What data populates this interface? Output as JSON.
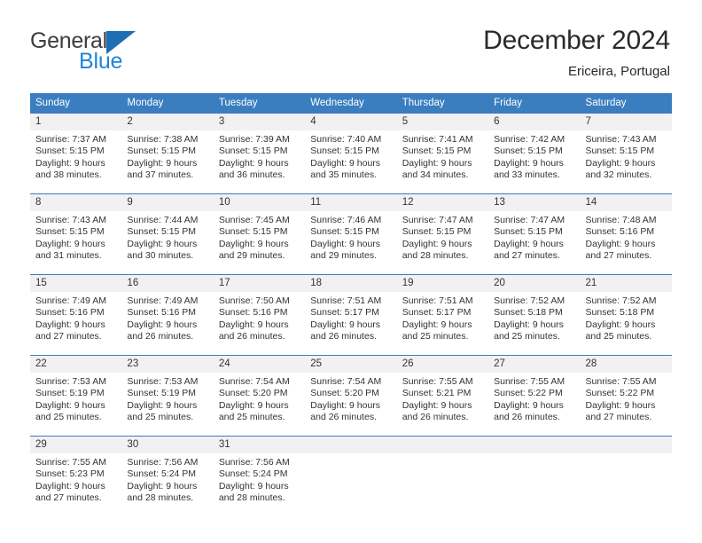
{
  "brand": {
    "name_top": "General",
    "name_bottom": "Blue",
    "triangle_color": "#1c6fb5",
    "blue_text_color": "#1f84d6"
  },
  "header": {
    "title": "December 2024",
    "subtitle": "Ericeira, Portugal"
  },
  "theme": {
    "header_blue": "#3a7ebf",
    "daynum_background": "#f1f1f1",
    "text_color": "#333333"
  },
  "weekdays": [
    "Sunday",
    "Monday",
    "Tuesday",
    "Wednesday",
    "Thursday",
    "Friday",
    "Saturday"
  ],
  "weeks": [
    {
      "days": [
        {
          "num": "1",
          "sunrise": "Sunrise: 7:37 AM",
          "sunset": "Sunset: 5:15 PM",
          "daylight1": "Daylight: 9 hours",
          "daylight2": "and 38 minutes."
        },
        {
          "num": "2",
          "sunrise": "Sunrise: 7:38 AM",
          "sunset": "Sunset: 5:15 PM",
          "daylight1": "Daylight: 9 hours",
          "daylight2": "and 37 minutes."
        },
        {
          "num": "3",
          "sunrise": "Sunrise: 7:39 AM",
          "sunset": "Sunset: 5:15 PM",
          "daylight1": "Daylight: 9 hours",
          "daylight2": "and 36 minutes."
        },
        {
          "num": "4",
          "sunrise": "Sunrise: 7:40 AM",
          "sunset": "Sunset: 5:15 PM",
          "daylight1": "Daylight: 9 hours",
          "daylight2": "and 35 minutes."
        },
        {
          "num": "5",
          "sunrise": "Sunrise: 7:41 AM",
          "sunset": "Sunset: 5:15 PM",
          "daylight1": "Daylight: 9 hours",
          "daylight2": "and 34 minutes."
        },
        {
          "num": "6",
          "sunrise": "Sunrise: 7:42 AM",
          "sunset": "Sunset: 5:15 PM",
          "daylight1": "Daylight: 9 hours",
          "daylight2": "and 33 minutes."
        },
        {
          "num": "7",
          "sunrise": "Sunrise: 7:43 AM",
          "sunset": "Sunset: 5:15 PM",
          "daylight1": "Daylight: 9 hours",
          "daylight2": "and 32 minutes."
        }
      ]
    },
    {
      "days": [
        {
          "num": "8",
          "sunrise": "Sunrise: 7:43 AM",
          "sunset": "Sunset: 5:15 PM",
          "daylight1": "Daylight: 9 hours",
          "daylight2": "and 31 minutes."
        },
        {
          "num": "9",
          "sunrise": "Sunrise: 7:44 AM",
          "sunset": "Sunset: 5:15 PM",
          "daylight1": "Daylight: 9 hours",
          "daylight2": "and 30 minutes."
        },
        {
          "num": "10",
          "sunrise": "Sunrise: 7:45 AM",
          "sunset": "Sunset: 5:15 PM",
          "daylight1": "Daylight: 9 hours",
          "daylight2": "and 29 minutes."
        },
        {
          "num": "11",
          "sunrise": "Sunrise: 7:46 AM",
          "sunset": "Sunset: 5:15 PM",
          "daylight1": "Daylight: 9 hours",
          "daylight2": "and 29 minutes."
        },
        {
          "num": "12",
          "sunrise": "Sunrise: 7:47 AM",
          "sunset": "Sunset: 5:15 PM",
          "daylight1": "Daylight: 9 hours",
          "daylight2": "and 28 minutes."
        },
        {
          "num": "13",
          "sunrise": "Sunrise: 7:47 AM",
          "sunset": "Sunset: 5:15 PM",
          "daylight1": "Daylight: 9 hours",
          "daylight2": "and 27 minutes."
        },
        {
          "num": "14",
          "sunrise": "Sunrise: 7:48 AM",
          "sunset": "Sunset: 5:16 PM",
          "daylight1": "Daylight: 9 hours",
          "daylight2": "and 27 minutes."
        }
      ]
    },
    {
      "days": [
        {
          "num": "15",
          "sunrise": "Sunrise: 7:49 AM",
          "sunset": "Sunset: 5:16 PM",
          "daylight1": "Daylight: 9 hours",
          "daylight2": "and 27 minutes."
        },
        {
          "num": "16",
          "sunrise": "Sunrise: 7:49 AM",
          "sunset": "Sunset: 5:16 PM",
          "daylight1": "Daylight: 9 hours",
          "daylight2": "and 26 minutes."
        },
        {
          "num": "17",
          "sunrise": "Sunrise: 7:50 AM",
          "sunset": "Sunset: 5:16 PM",
          "daylight1": "Daylight: 9 hours",
          "daylight2": "and 26 minutes."
        },
        {
          "num": "18",
          "sunrise": "Sunrise: 7:51 AM",
          "sunset": "Sunset: 5:17 PM",
          "daylight1": "Daylight: 9 hours",
          "daylight2": "and 26 minutes."
        },
        {
          "num": "19",
          "sunrise": "Sunrise: 7:51 AM",
          "sunset": "Sunset: 5:17 PM",
          "daylight1": "Daylight: 9 hours",
          "daylight2": "and 25 minutes."
        },
        {
          "num": "20",
          "sunrise": "Sunrise: 7:52 AM",
          "sunset": "Sunset: 5:18 PM",
          "daylight1": "Daylight: 9 hours",
          "daylight2": "and 25 minutes."
        },
        {
          "num": "21",
          "sunrise": "Sunrise: 7:52 AM",
          "sunset": "Sunset: 5:18 PM",
          "daylight1": "Daylight: 9 hours",
          "daylight2": "and 25 minutes."
        }
      ]
    },
    {
      "days": [
        {
          "num": "22",
          "sunrise": "Sunrise: 7:53 AM",
          "sunset": "Sunset: 5:19 PM",
          "daylight1": "Daylight: 9 hours",
          "daylight2": "and 25 minutes."
        },
        {
          "num": "23",
          "sunrise": "Sunrise: 7:53 AM",
          "sunset": "Sunset: 5:19 PM",
          "daylight1": "Daylight: 9 hours",
          "daylight2": "and 25 minutes."
        },
        {
          "num": "24",
          "sunrise": "Sunrise: 7:54 AM",
          "sunset": "Sunset: 5:20 PM",
          "daylight1": "Daylight: 9 hours",
          "daylight2": "and 25 minutes."
        },
        {
          "num": "25",
          "sunrise": "Sunrise: 7:54 AM",
          "sunset": "Sunset: 5:20 PM",
          "daylight1": "Daylight: 9 hours",
          "daylight2": "and 26 minutes."
        },
        {
          "num": "26",
          "sunrise": "Sunrise: 7:55 AM",
          "sunset": "Sunset: 5:21 PM",
          "daylight1": "Daylight: 9 hours",
          "daylight2": "and 26 minutes."
        },
        {
          "num": "27",
          "sunrise": "Sunrise: 7:55 AM",
          "sunset": "Sunset: 5:22 PM",
          "daylight1": "Daylight: 9 hours",
          "daylight2": "and 26 minutes."
        },
        {
          "num": "28",
          "sunrise": "Sunrise: 7:55 AM",
          "sunset": "Sunset: 5:22 PM",
          "daylight1": "Daylight: 9 hours",
          "daylight2": "and 27 minutes."
        }
      ]
    },
    {
      "days": [
        {
          "num": "29",
          "sunrise": "Sunrise: 7:55 AM",
          "sunset": "Sunset: 5:23 PM",
          "daylight1": "Daylight: 9 hours",
          "daylight2": "and 27 minutes."
        },
        {
          "num": "30",
          "sunrise": "Sunrise: 7:56 AM",
          "sunset": "Sunset: 5:24 PM",
          "daylight1": "Daylight: 9 hours",
          "daylight2": "and 28 minutes."
        },
        {
          "num": "31",
          "sunrise": "Sunrise: 7:56 AM",
          "sunset": "Sunset: 5:24 PM",
          "daylight1": "Daylight: 9 hours",
          "daylight2": "and 28 minutes."
        },
        {
          "num": "",
          "sunrise": "",
          "sunset": "",
          "daylight1": "",
          "daylight2": ""
        },
        {
          "num": "",
          "sunrise": "",
          "sunset": "",
          "daylight1": "",
          "daylight2": ""
        },
        {
          "num": "",
          "sunrise": "",
          "sunset": "",
          "daylight1": "",
          "daylight2": ""
        },
        {
          "num": "",
          "sunrise": "",
          "sunset": "",
          "daylight1": "",
          "daylight2": ""
        }
      ]
    }
  ]
}
